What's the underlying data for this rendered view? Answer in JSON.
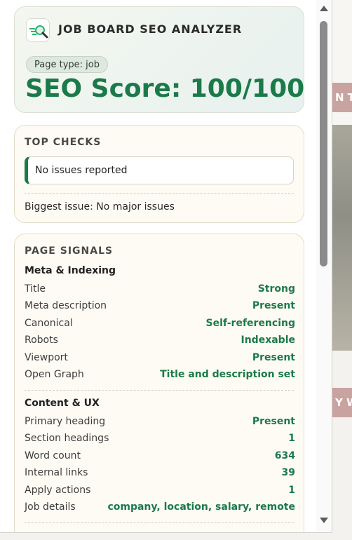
{
  "header": {
    "app_title": "JOB BOARD SEO ANALYZER",
    "page_type": "Page type: job",
    "score": "SEO Score: 100/100"
  },
  "top_checks": {
    "title": "TOP CHECKS",
    "issue": "No issues reported",
    "biggest_issue": "Biggest issue: No major issues"
  },
  "page_signals": {
    "title": "PAGE SIGNALS",
    "groups": [
      {
        "name": "Meta & Indexing",
        "rows": [
          {
            "label": "Title",
            "value": "Strong"
          },
          {
            "label": "Meta description",
            "value": "Present"
          },
          {
            "label": "Canonical",
            "value": "Self-referencing"
          },
          {
            "label": "Robots",
            "value": "Indexable"
          },
          {
            "label": "Viewport",
            "value": "Present"
          },
          {
            "label": "Open Graph",
            "value": "Title and description set"
          }
        ]
      },
      {
        "name": "Content & UX",
        "rows": [
          {
            "label": "Primary heading",
            "value": "Present"
          },
          {
            "label": "Section headings",
            "value": "1"
          },
          {
            "label": "Word count",
            "value": "634"
          },
          {
            "label": "Internal links",
            "value": "39"
          },
          {
            "label": "Apply actions",
            "value": "1"
          },
          {
            "label": "Job details",
            "value": "company, location, salary, remote"
          }
        ]
      }
    ]
  },
  "background": {
    "tab_top_text": "N T",
    "tab_bottom_text": "Y W"
  },
  "colors": {
    "accent_green": "#1c7a4a",
    "card_bg": "#fdfbf4"
  }
}
